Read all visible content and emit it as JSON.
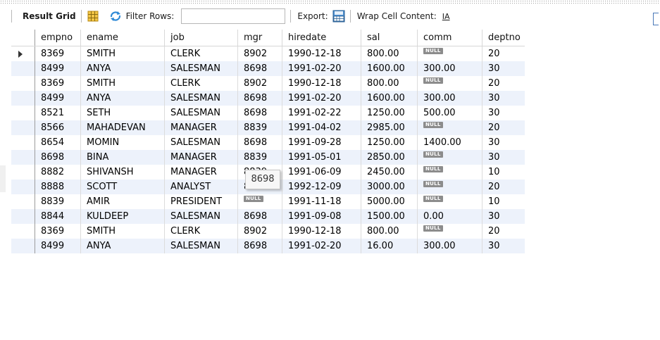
{
  "toolbar": {
    "result_grid_label": "Result Grid",
    "filter_rows_label": "Filter Rows:",
    "filter_value": "",
    "export_label": "Export:",
    "wrap_label": "Wrap Cell Content:",
    "wrap_icon_text": "IA"
  },
  "null_label": "NULL",
  "columns": [
    "empno",
    "ename",
    "job",
    "mgr",
    "hiredate",
    "sal",
    "comm",
    "deptno"
  ],
  "rows": [
    {
      "empno": "8369",
      "ename": "SMITH",
      "job": "CLERK",
      "mgr": "8902",
      "hiredate": "1990-12-18",
      "sal": "800.00",
      "comm": null,
      "deptno": "20"
    },
    {
      "empno": "8499",
      "ename": "ANYA",
      "job": "SALESMAN",
      "mgr": "8698",
      "hiredate": "1991-02-20",
      "sal": "1600.00",
      "comm": "300.00",
      "deptno": "30"
    },
    {
      "empno": "8369",
      "ename": "SMITH",
      "job": "CLERK",
      "mgr": "8902",
      "hiredate": "1990-12-18",
      "sal": "800.00",
      "comm": null,
      "deptno": "20"
    },
    {
      "empno": "8499",
      "ename": "ANYA",
      "job": "SALESMAN",
      "mgr": "8698",
      "hiredate": "1991-02-20",
      "sal": "1600.00",
      "comm": "300.00",
      "deptno": "30"
    },
    {
      "empno": "8521",
      "ename": "SETH",
      "job": "SALESMAN",
      "mgr": "8698",
      "hiredate": "1991-02-22",
      "sal": "1250.00",
      "comm": "500.00",
      "deptno": "30"
    },
    {
      "empno": "8566",
      "ename": "MAHADEVAN",
      "job": "MANAGER",
      "mgr": "8839",
      "hiredate": "1991-04-02",
      "sal": "2985.00",
      "comm": null,
      "deptno": "20"
    },
    {
      "empno": "8654",
      "ename": "MOMIN",
      "job": "SALESMAN",
      "mgr": "8698",
      "hiredate": "1991-09-28",
      "sal": "1250.00",
      "comm": "1400.00",
      "deptno": "30"
    },
    {
      "empno": "8698",
      "ename": "BINA",
      "job": "MANAGER",
      "mgr": "8839",
      "hiredate": "1991-05-01",
      "sal": "2850.00",
      "comm": null,
      "deptno": "30"
    },
    {
      "empno": "8882",
      "ename": "SHIVANSH",
      "job": "MANAGER",
      "mgr": "8839",
      "hiredate": "1991-06-09",
      "sal": "2450.00",
      "comm": null,
      "deptno": "10"
    },
    {
      "empno": "8888",
      "ename": "SCOTT",
      "job": "ANALYST",
      "mgr": "8566",
      "hiredate": "1992-12-09",
      "sal": "3000.00",
      "comm": null,
      "deptno": "20"
    },
    {
      "empno": "8839",
      "ename": "AMIR",
      "job": "PRESIDENT",
      "mgr": null,
      "hiredate": "1991-11-18",
      "sal": "5000.00",
      "comm": null,
      "deptno": "10"
    },
    {
      "empno": "8844",
      "ename": "KULDEEP",
      "job": "SALESMAN",
      "mgr": "8698",
      "hiredate": "1991-09-08",
      "sal": "1500.00",
      "comm": "0.00",
      "deptno": "30"
    },
    {
      "empno": "8369",
      "ename": "SMITH",
      "job": "CLERK",
      "mgr": "8902",
      "hiredate": "1990-12-18",
      "sal": "800.00",
      "comm": null,
      "deptno": "20"
    },
    {
      "empno": "8499",
      "ename": "ANYA",
      "job": "SALESMAN",
      "mgr": "8698",
      "hiredate": "1991-02-20",
      "sal": "16.00",
      "comm": "300.00",
      "deptno": "30"
    }
  ],
  "tooltip": {
    "text": "8698"
  },
  "colors": {
    "alt_row": "#edf2fb",
    "null_badge": "#8c8c8c"
  }
}
